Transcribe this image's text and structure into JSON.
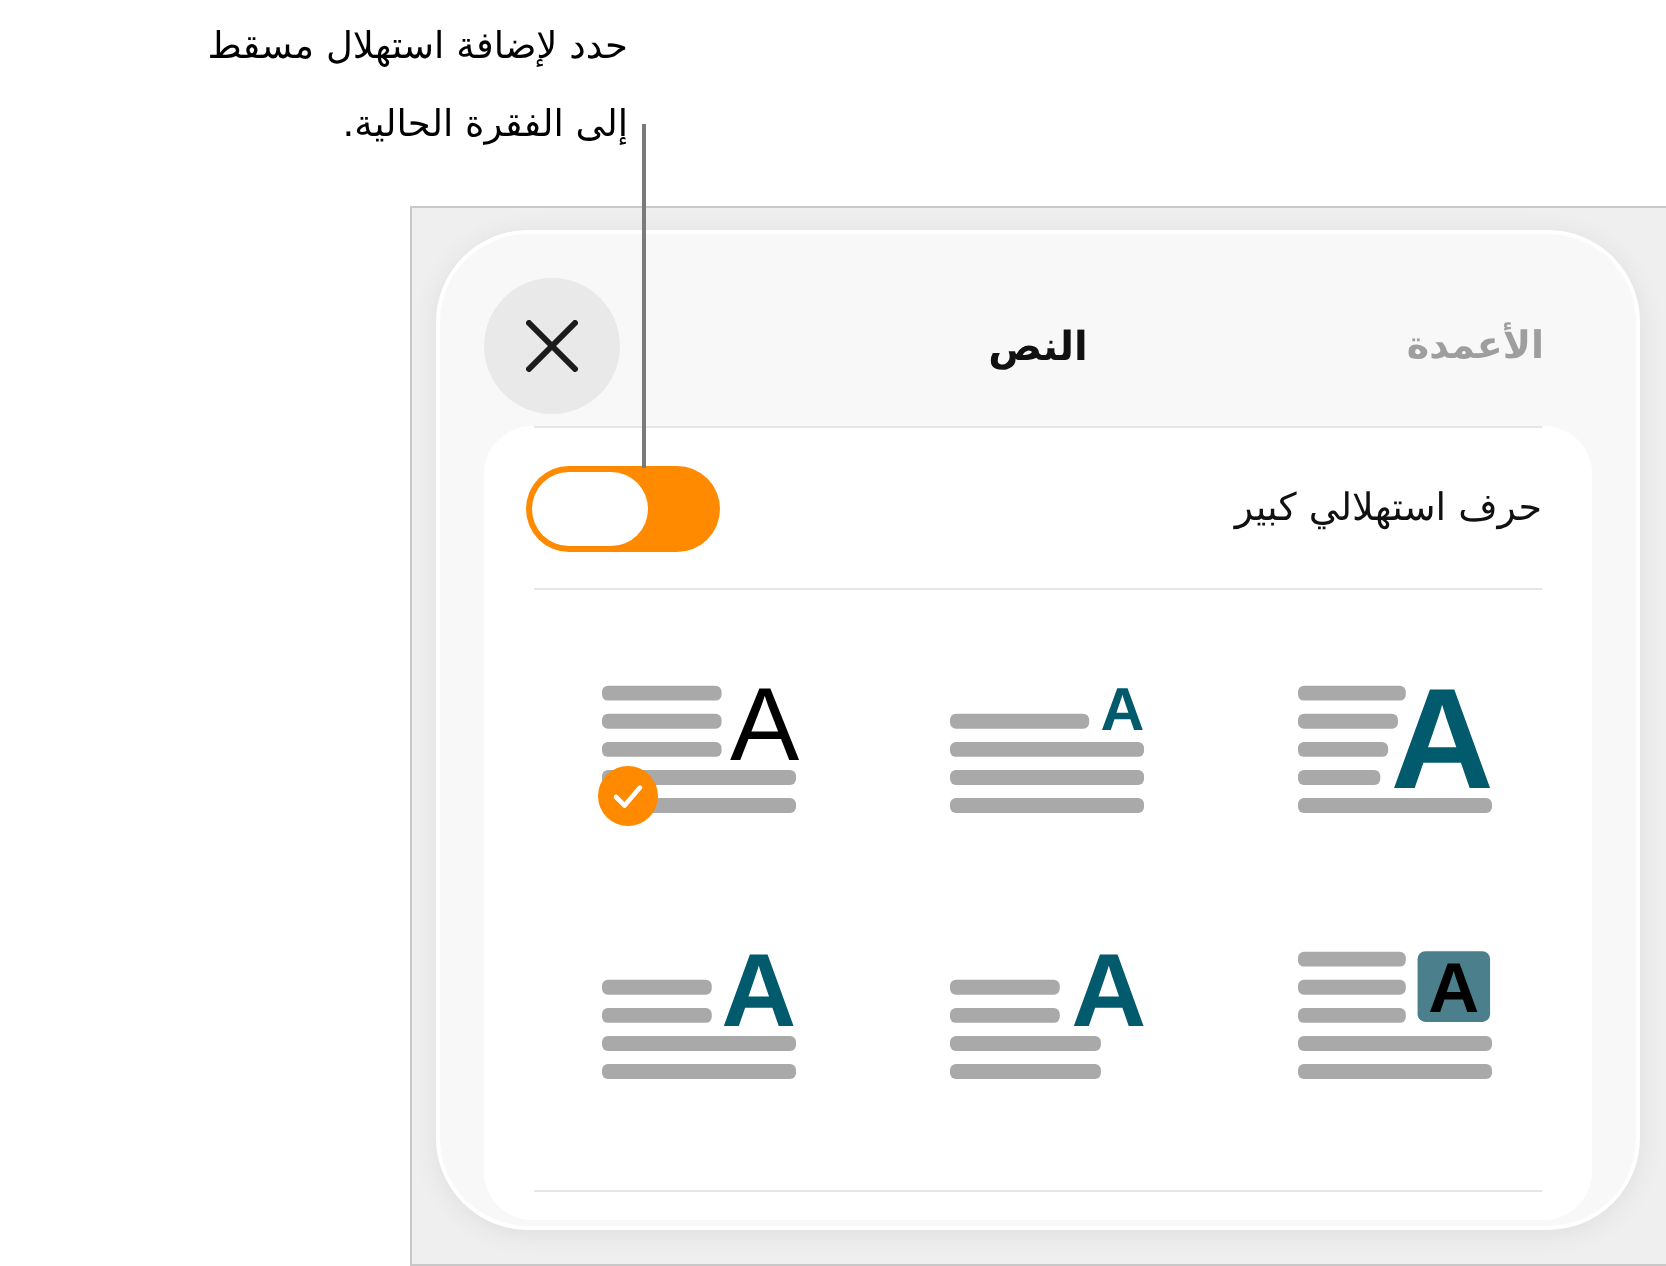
{
  "callout": {
    "text": "حدد لإضافة استهلال مسقط إلى الفقرة الحالية."
  },
  "header": {
    "title": "النص",
    "faded_tab": "الأعمدة"
  },
  "drop_cap": {
    "label": "حرف استهلالي كبير",
    "on": true
  },
  "styles": [
    {
      "kind": "dropped",
      "letter": "A",
      "selected": false
    },
    {
      "kind": "raised",
      "letter": "A",
      "selected": false
    },
    {
      "kind": "plain",
      "letter": "A",
      "selected": true
    },
    {
      "kind": "boxed",
      "letter": "A",
      "selected": false
    },
    {
      "kind": "inset-short",
      "letter": "A",
      "selected": false
    },
    {
      "kind": "inset",
      "letter": "A",
      "selected": false
    }
  ]
}
